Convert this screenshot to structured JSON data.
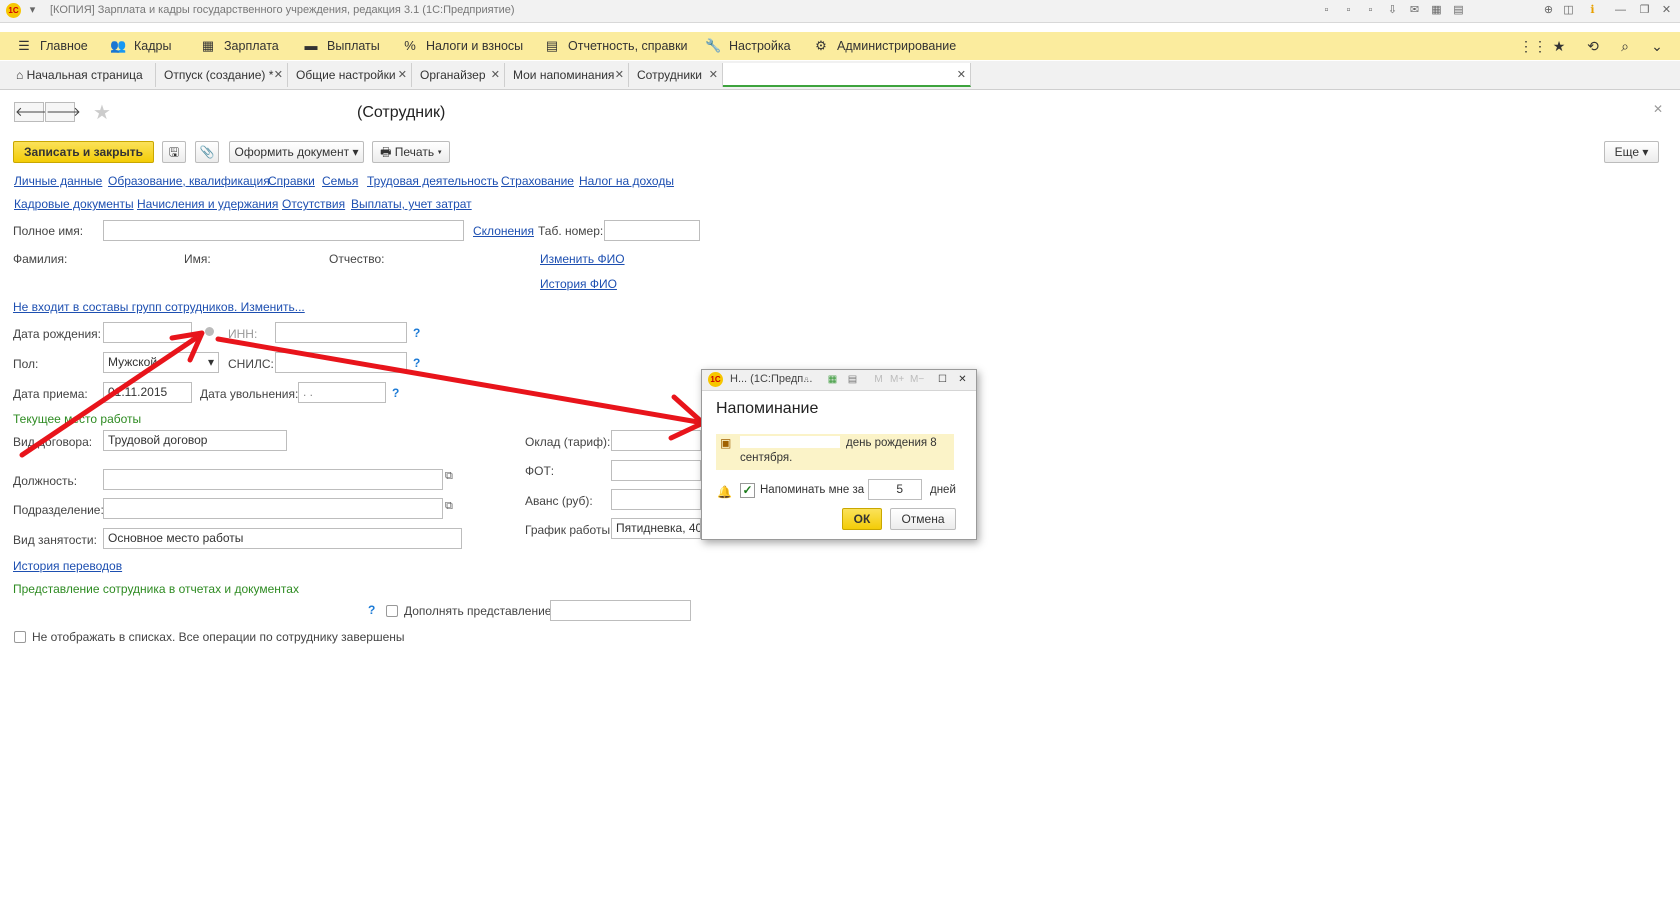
{
  "window": {
    "title": "[КОПИЯ] Зарплата и кадры государственного учреждения, редакция 3.1  (1С:Предприятие)",
    "logo": "1С"
  },
  "menu": {
    "items": [
      {
        "label": "Главное",
        "icon": "hamburger-icon"
      },
      {
        "label": "Кадры",
        "icon": "people-icon"
      },
      {
        "label": "Зарплата",
        "icon": "calculator-icon"
      },
      {
        "label": "Выплаты",
        "icon": "wallet-icon"
      },
      {
        "label": "Налоги и взносы",
        "icon": "percent-icon"
      },
      {
        "label": "Отчетность, справки",
        "icon": "report-icon"
      },
      {
        "label": "Настройка",
        "icon": "wrench-icon"
      },
      {
        "label": "Администрирование",
        "icon": "gear-icon"
      }
    ]
  },
  "tabs": [
    {
      "label": "Начальная страница",
      "icon": "home-icon"
    },
    {
      "label": "Отпуск (создание) *"
    },
    {
      "label": "Общие настройки"
    },
    {
      "label": "Органайзер"
    },
    {
      "label": "Мои напоминания"
    },
    {
      "label": "Сотрудники"
    },
    {
      "label": ""
    }
  ],
  "form": {
    "title": "(Сотрудник)",
    "save_close": "Записать и закрыть",
    "issue_doc": "Оформить документ",
    "print": "Печать",
    "more": "Еще",
    "links_row1": [
      "Личные данные",
      "Образование, квалификация",
      "Справки",
      "Семья",
      "Трудовая деятельность",
      "Страхование",
      "Налог на доходы"
    ],
    "links_row2": [
      "Кадровые документы",
      "Начисления и удержания",
      "Отсутствия",
      "Выплаты, учет затрат"
    ],
    "full_name_label": "Полное имя:",
    "declension_link": "Склонения",
    "tab_number_label": "Таб. номер:",
    "surname_label": "Фамилия:",
    "name_label": "Имя:",
    "patronymic_label": "Отчество:",
    "change_fio_link": "Изменить ФИО",
    "fio_history_link": "История ФИО",
    "groups_link": "Не входит в составы групп сотрудников. Изменить...",
    "birth_date_label": "Дата рождения:",
    "inn_label": "ИНН:",
    "gender_label": "Пол:",
    "gender_value": "Мужской",
    "snils_label": "СНИЛС:",
    "hire_date_label": "Дата приема:",
    "hire_date_value": "01.11.2015",
    "dismissal_date_label": "Дата увольнения:",
    "dismissal_date_value": " .  .",
    "current_job_section": "Текущее место работы",
    "contract_type_label": "Вид договора:",
    "contract_type_value": "Трудовой договор",
    "salary_label": "Оклад (тариф):",
    "fot_label": "ФОТ:",
    "position_label": "Должность:",
    "department_label": "Подразделение:",
    "advance_label": "Аванс (руб):",
    "employment_type_label": "Вид занятости:",
    "employment_type_value": "Основное место работы",
    "schedule_label": "График работы:",
    "schedule_value": "Пятидневка, 40 ч",
    "transfer_history_link": "История переводов",
    "representation_section": "Представление сотрудника в отчетах и документах",
    "supplement_label": "Дополнять представление",
    "hide_label": "Не отображать в списках. Все операции по сотруднику завершены",
    "help_mark": "?"
  },
  "popup": {
    "title": "Н...  (1С:Предп...",
    "heading": "Напоминание",
    "message": "день рождения 8 сентября.",
    "remind_label": "Напоминать мне за",
    "remind_value": "5",
    "days_label": "дней",
    "ok": "ОК",
    "cancel": "Отмена"
  },
  "colors": {
    "menu_bg": "#fbec9e",
    "accent_yellow": "#f3cc07",
    "link": "#1d4fb1",
    "section_green": "#2e8b22",
    "arrow_red": "#e8141b"
  }
}
